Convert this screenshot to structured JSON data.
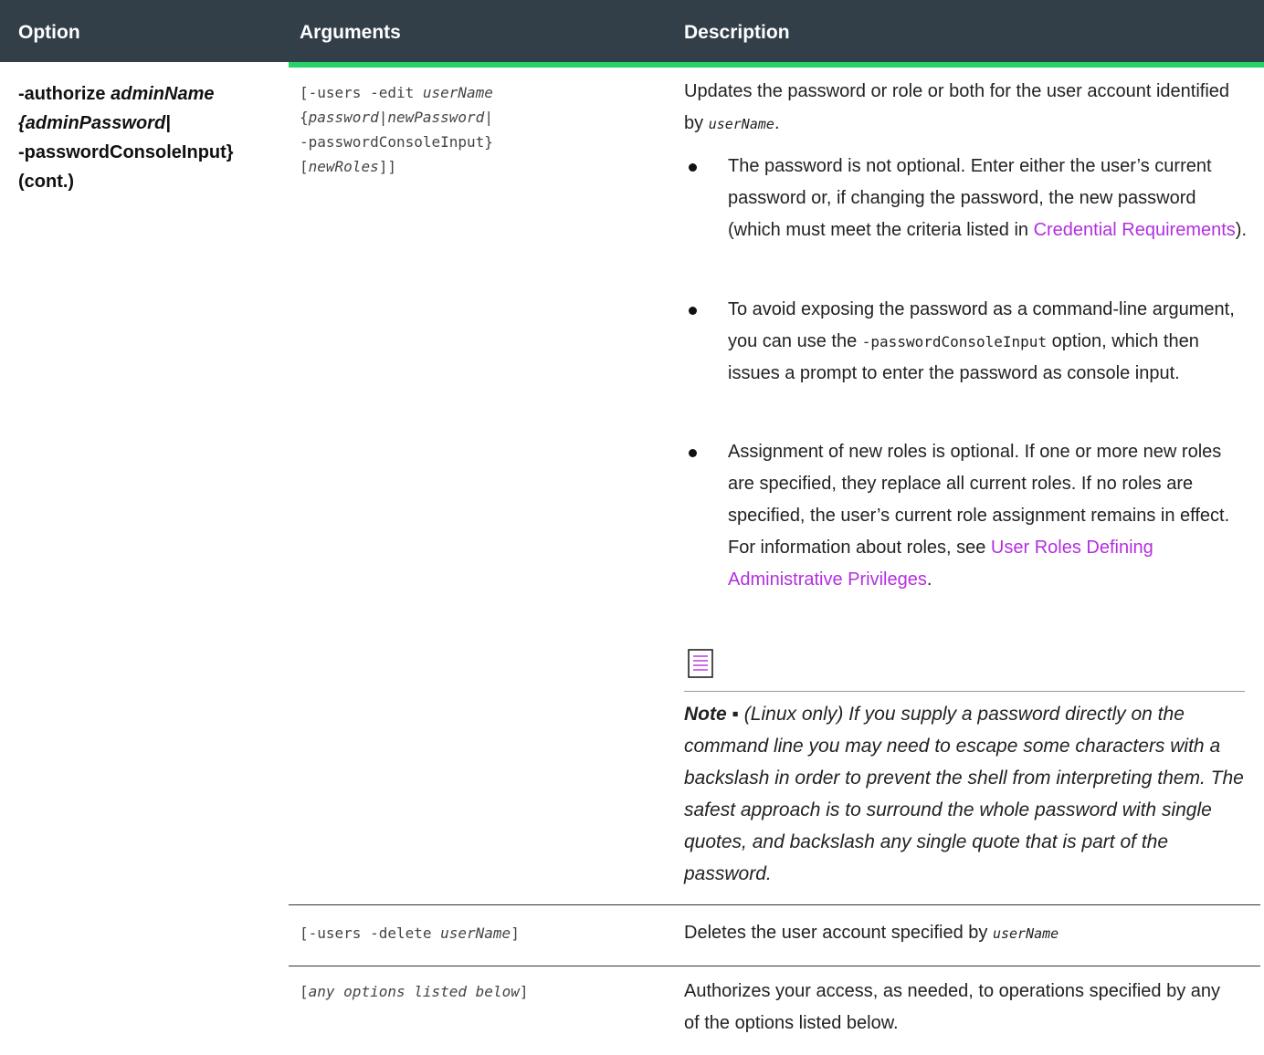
{
  "header": {
    "option": "Option",
    "arguments": "Arguments",
    "description": "Description"
  },
  "option": {
    "prefix": "-authorize ",
    "admin_name": "adminName",
    "line2": "{adminPassword|",
    "line3": "-passwordConsoleInput}",
    "line4": "(cont.)"
  },
  "rows": {
    "edit": {
      "args": {
        "a": "[-users -edit ",
        "b": "userName",
        "c": "{",
        "d": "password",
        "e": "|",
        "f": "newPassword",
        "g": "|",
        "h": "-passwordConsoleInput}",
        "i": "[",
        "j": "newRoles",
        "k": "]]"
      },
      "desc": {
        "a": "Updates the password or role or both for the user account identified by ",
        "b": "userName",
        "c": "."
      },
      "bullets": {
        "b1": {
          "a": "The password is not optional. Enter either the user’s current password or, if changing the password, the new password (which must meet the criteria listed in ",
          "link": "Credential Requirements",
          "c": ")."
        },
        "b2": {
          "a": "To avoid exposing the password as a command-line argument, you can use the ",
          "mono": "-passwordConsoleInput",
          "c": " option, which then issues a prompt to enter the password as console input."
        },
        "b3": {
          "a": "Assignment of new roles is optional. If one or more new roles are specified, they replace all current roles. If no roles are specified, the user’s current role assignment remains in effect. For information about roles, see ",
          "link": "User Roles Defining Administrative Privileges",
          "c": "."
        }
      },
      "note": {
        "label": "Note",
        "sep": " ▪ ",
        "text": "(Linux only) If you supply a password directly on the command line you may need to escape some characters with a backslash in order to prevent the shell from interpreting them. The safest approach is to surround the whole password with single quotes, and backslash any single quote that is part of the password."
      }
    },
    "delete": {
      "args": {
        "a": "[-users -delete ",
        "b": "userName",
        "c": "]"
      },
      "desc": {
        "a": "Deletes the user account specified by ",
        "b": "userName"
      }
    },
    "any": {
      "args": {
        "a": "[",
        "b": "any options listed below",
        "c": "]"
      },
      "desc": "Authorizes your access, as needed, to operations specified by any of the options listed below."
    }
  },
  "icons": {
    "note": "note-icon"
  },
  "colors": {
    "header_bg": "#323e48",
    "accent": "#25d366",
    "link": "#b32fe0"
  }
}
